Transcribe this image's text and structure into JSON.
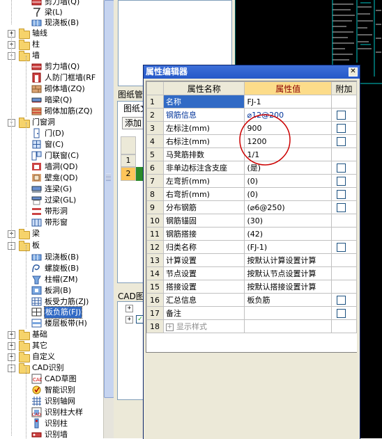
{
  "tree": {
    "items": [
      {
        "type": "child",
        "label": "剪力墙(Q)",
        "icon": "shear-wall-icon",
        "clip": true
      },
      {
        "type": "child",
        "label": "梁(L)",
        "icon": "beam-icon"
      },
      {
        "type": "child",
        "label": "现浇板(B)",
        "icon": "slab-icon"
      },
      {
        "type": "folder",
        "label": "轴线",
        "state": "+"
      },
      {
        "type": "folder",
        "label": "柱",
        "state": "+"
      },
      {
        "type": "folder",
        "label": "墙",
        "state": "-"
      },
      {
        "type": "child",
        "label": "剪力墙(Q)",
        "icon": "shear-wall-icon"
      },
      {
        "type": "child",
        "label": "人防门框墙(RF",
        "icon": "civil-defense-wall-icon"
      },
      {
        "type": "child",
        "label": "砌体墙(ZQ)",
        "icon": "masonry-wall-icon"
      },
      {
        "type": "child",
        "label": "暗梁(Q)",
        "icon": "hidden-beam-icon"
      },
      {
        "type": "child",
        "label": "砌体加筋(ZQ)",
        "icon": "masonry-rebar-icon"
      },
      {
        "type": "folder",
        "label": "门窗洞",
        "state": "-"
      },
      {
        "type": "child",
        "label": "门(D)",
        "icon": "door-icon"
      },
      {
        "type": "child",
        "label": "窗(C)",
        "icon": "window-icon"
      },
      {
        "type": "child",
        "label": "门联窗(C)",
        "icon": "door-window-icon"
      },
      {
        "type": "child",
        "label": "墙洞(QD)",
        "icon": "wall-opening-icon"
      },
      {
        "type": "child",
        "label": "壁龛(QD)",
        "icon": "niche-icon"
      },
      {
        "type": "child",
        "label": "连梁(G)",
        "icon": "coupling-beam-icon"
      },
      {
        "type": "child",
        "label": "过梁(GL)",
        "icon": "lintel-icon"
      },
      {
        "type": "child",
        "label": "带形洞",
        "icon": "strip-opening-icon"
      },
      {
        "type": "child",
        "label": "带形窗",
        "icon": "strip-window-icon"
      },
      {
        "type": "folder",
        "label": "梁",
        "state": "+"
      },
      {
        "type": "folder",
        "label": "板",
        "state": "-"
      },
      {
        "type": "child",
        "label": "现浇板(B)",
        "icon": "slab-icon"
      },
      {
        "type": "child",
        "label": "螺旋板(B)",
        "icon": "spiral-slab-icon"
      },
      {
        "type": "child",
        "label": "柱帽(ZM)",
        "icon": "column-cap-icon"
      },
      {
        "type": "child",
        "label": "板洞(B)",
        "icon": "slab-opening-icon"
      },
      {
        "type": "child",
        "label": "板受力筋(ZJ)",
        "icon": "slab-rebar-icon"
      },
      {
        "type": "child",
        "label": "板负筋(FJ)",
        "icon": "negative-rebar-icon",
        "selected": true
      },
      {
        "type": "child",
        "label": "楼层板带(H)",
        "icon": "floor-band-icon"
      },
      {
        "type": "folder",
        "label": "基础",
        "state": "+"
      },
      {
        "type": "folder",
        "label": "其它",
        "state": "+"
      },
      {
        "type": "folder",
        "label": "自定义",
        "state": "+"
      },
      {
        "type": "folder",
        "label": "CAD识别",
        "state": "-"
      },
      {
        "type": "child",
        "label": "CAD草图",
        "icon": "cad-sketch-icon"
      },
      {
        "type": "child",
        "label": "智能识别",
        "icon": "smart-recognize-icon"
      },
      {
        "type": "child",
        "label": "识别轴网",
        "icon": "recognize-grid-icon"
      },
      {
        "type": "child",
        "label": "识别柱大样",
        "icon": "recognize-column-detail-icon"
      },
      {
        "type": "child",
        "label": "识别柱",
        "icon": "recognize-column-icon"
      },
      {
        "type": "child",
        "label": "识别墙",
        "icon": "recognize-wall-icon",
        "clip": true
      }
    ]
  },
  "middle": {
    "tab1": "图纸管",
    "tab2": "图纸文",
    "add_button": "添加",
    "rows": [
      "1",
      "2"
    ],
    "cad_tab": "CAD图"
  },
  "editor": {
    "title": "属性编辑器",
    "col_name": "属性名称",
    "col_value": "属性值",
    "col_extra": "附加",
    "rows": [
      {
        "n": "1",
        "name": "名称",
        "value": "FJ-1",
        "check": false,
        "sel": true
      },
      {
        "n": "2",
        "name": "钢筋信息",
        "value": "⌀12@200",
        "check": true,
        "blue": true
      },
      {
        "n": "3",
        "name": "左标注(mm)",
        "value": "900",
        "check": true
      },
      {
        "n": "4",
        "name": "右标注(mm)",
        "value": "1200",
        "check": true
      },
      {
        "n": "5",
        "name": "马凳筋排数",
        "value": "1/1",
        "check": false
      },
      {
        "n": "6",
        "name": "非单边标注含支座",
        "value": "(是)",
        "check": true
      },
      {
        "n": "7",
        "name": "左弯折(mm)",
        "value": "(0)",
        "check": true
      },
      {
        "n": "8",
        "name": "右弯折(mm)",
        "value": "(0)",
        "check": true
      },
      {
        "n": "9",
        "name": "分布钢筋",
        "value": "(⌀6@250)",
        "check": true
      },
      {
        "n": "10",
        "name": "钢筋锚固",
        "value": "(30)",
        "check": false
      },
      {
        "n": "11",
        "name": "钢筋搭接",
        "value": "(42)",
        "check": false
      },
      {
        "n": "12",
        "name": "归类名称",
        "value": "(FJ-1)",
        "check": true
      },
      {
        "n": "13",
        "name": "计算设置",
        "value": "按默认计算设置计算",
        "check": false
      },
      {
        "n": "14",
        "name": "节点设置",
        "value": "按默认节点设置计算",
        "check": false
      },
      {
        "n": "15",
        "name": "搭接设置",
        "value": "按默认搭接设置计算",
        "check": false
      },
      {
        "n": "16",
        "name": "汇总信息",
        "value": "板负筋",
        "check": true
      },
      {
        "n": "17",
        "name": "备注",
        "value": "",
        "check": true
      },
      {
        "n": "18",
        "name": "显示样式",
        "value": "",
        "check": false,
        "expand": true,
        "gray": true
      }
    ]
  },
  "colors": {
    "titlebar": "#2558c8",
    "selection": "#316ac5",
    "header_value": "#fcdc8a",
    "annotation": "#cc0000"
  }
}
